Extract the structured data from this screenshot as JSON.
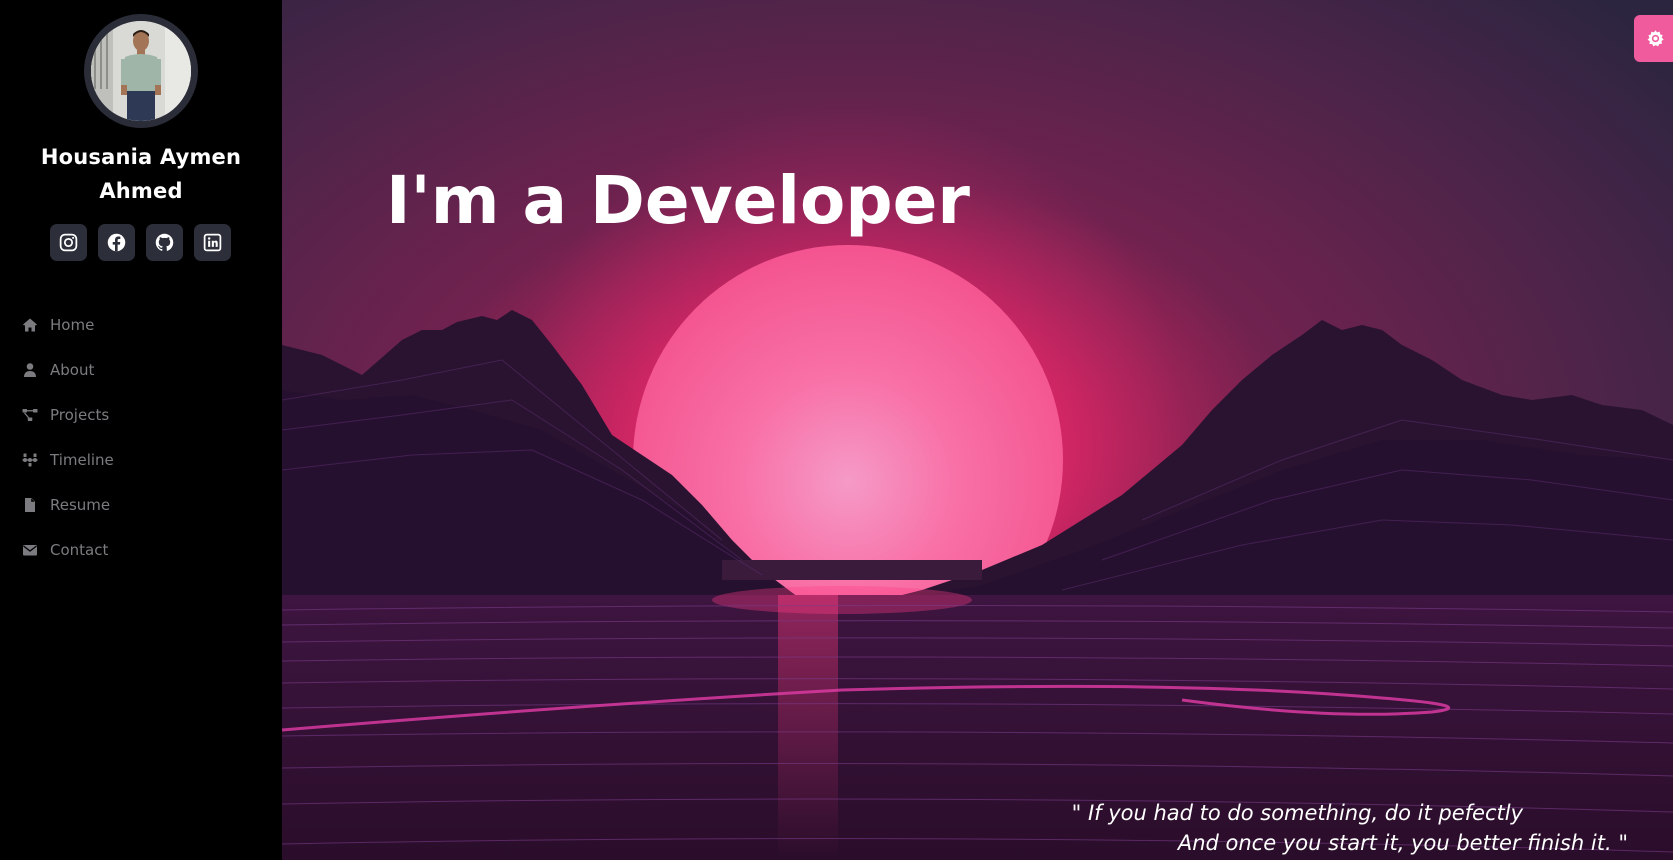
{
  "profile": {
    "name_line1": "Housania Aymen",
    "name_line2": "Ahmed"
  },
  "socials": [
    {
      "icon": "instagram-icon"
    },
    {
      "icon": "facebook-icon"
    },
    {
      "icon": "github-icon"
    },
    {
      "icon": "linkedin-icon"
    }
  ],
  "nav": {
    "items": [
      {
        "label": "Home",
        "icon": "home-icon"
      },
      {
        "label": "About",
        "icon": "user-icon"
      },
      {
        "label": "Projects",
        "icon": "project-diagram-icon"
      },
      {
        "label": "Timeline",
        "icon": "timeline-icon"
      },
      {
        "label": "Resume",
        "icon": "file-icon"
      },
      {
        "label": "Contact",
        "icon": "envelope-icon"
      }
    ]
  },
  "hero": {
    "prefix": "I'm a ",
    "role": "Developer",
    "quote_line1": "\" If you had to do something, do it pefectly",
    "quote_line2": "And once you start it, you better finish it. \""
  },
  "theme_toggle": {
    "icon": "gear-icon"
  },
  "colors": {
    "sidebar_bg": "#000000",
    "social_bg": "#2c2f3a",
    "nav_text": "#7c7c80",
    "accent": "#ef5b9c",
    "sun": "#f76aa3"
  }
}
